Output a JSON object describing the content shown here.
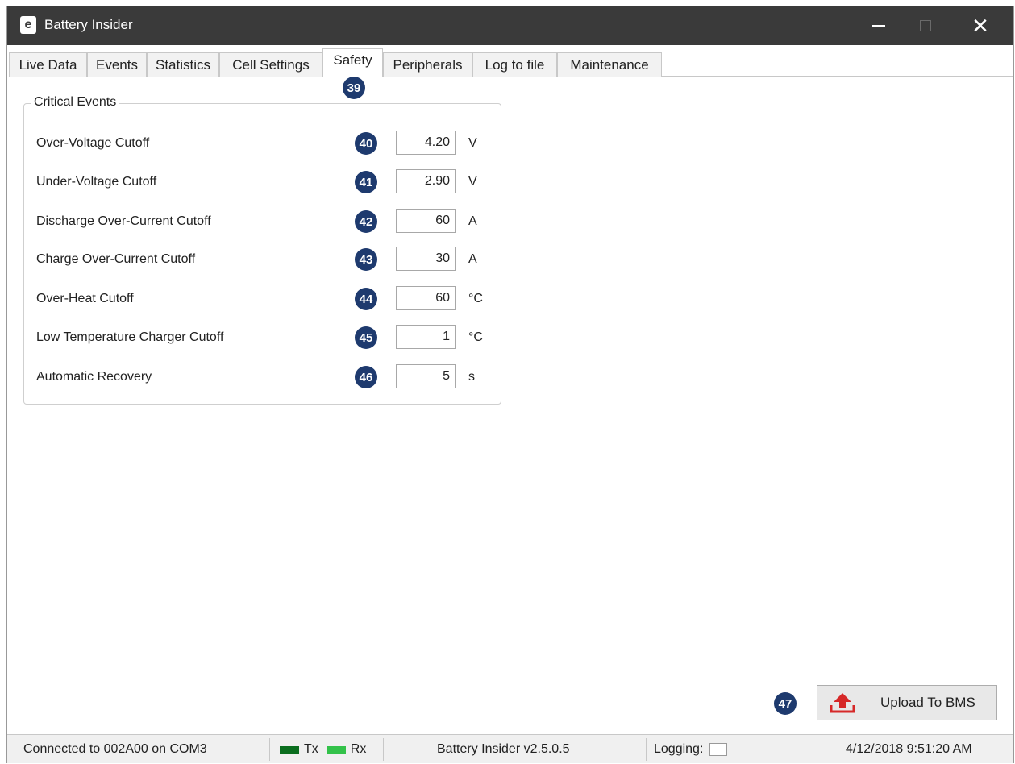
{
  "window": {
    "title": "Battery Insider",
    "logo_glyph": "e"
  },
  "tabs": [
    {
      "label": "Live Data"
    },
    {
      "label": "Events"
    },
    {
      "label": "Statistics"
    },
    {
      "label": "Cell Settings"
    },
    {
      "label": "Safety",
      "active": true
    },
    {
      "label": "Peripherals"
    },
    {
      "label": "Log to file"
    },
    {
      "label": "Maintenance"
    }
  ],
  "callouts": {
    "safety_tab": "39",
    "upload": "47"
  },
  "critical_events": {
    "title": "Critical Events",
    "rows": [
      {
        "callout": "40",
        "label": "Over-Voltage Cutoff",
        "value": "4.20",
        "unit": "V"
      },
      {
        "callout": "41",
        "label": "Under-Voltage Cutoff",
        "value": "2.90",
        "unit": "V"
      },
      {
        "callout": "42",
        "label": "Discharge Over-Current Cutoff",
        "value": "60",
        "unit": "A"
      },
      {
        "callout": "43",
        "label": "Charge Over-Current Cutoff",
        "value": "30",
        "unit": "A"
      },
      {
        "callout": "44",
        "label": "Over-Heat Cutoff",
        "value": "60",
        "unit": "°C"
      },
      {
        "callout": "45",
        "label": "Low Temperature Charger Cutoff",
        "value": "1",
        "unit": "°C"
      },
      {
        "callout": "46",
        "label": "Automatic Recovery",
        "value": "5",
        "unit": "s"
      }
    ]
  },
  "upload": {
    "label": "Upload To BMS",
    "icon": "upload-icon"
  },
  "statusbar": {
    "connection": "Connected to 002A00 on COM3",
    "tx": "Tx",
    "rx": "Rx",
    "version": "Battery Insider v2.5.0.5",
    "logging_label": "Logging:",
    "datetime": "4/12/2018 9:51:20 AM"
  },
  "colors": {
    "badge": "#1e3a6e",
    "upload_icon": "#d62828",
    "tx_led": "#0b6e1f",
    "rx_led": "#33c24a",
    "titlebar": "#3a3a3a"
  }
}
